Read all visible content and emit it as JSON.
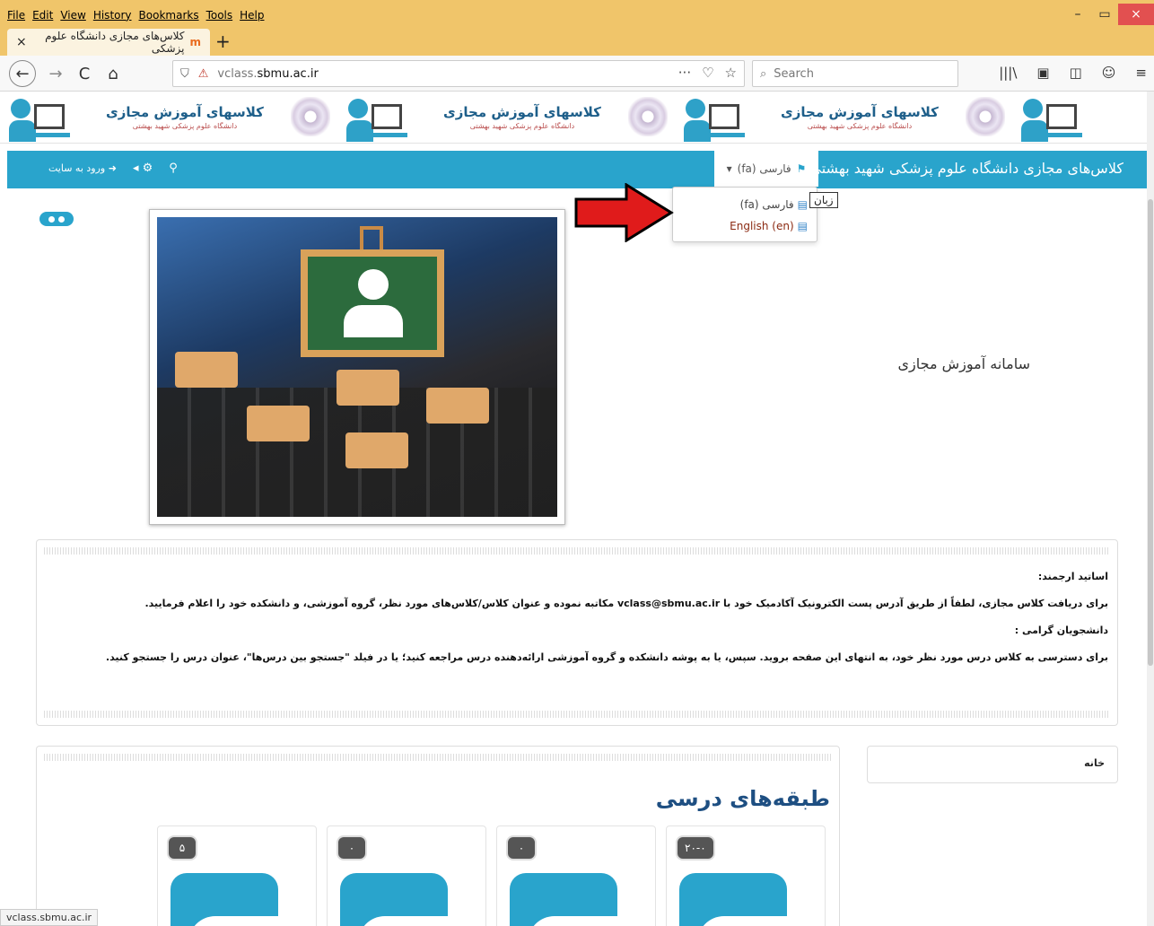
{
  "browser": {
    "menus": [
      "File",
      "Edit",
      "View",
      "History",
      "Bookmarks",
      "Tools",
      "Help"
    ],
    "window_controls": [
      "–",
      "▭",
      "×"
    ],
    "tab_title": "کلاس‌های مجازی دانشگاه علوم پزشکی",
    "tab_favicon": "m",
    "tab_close": "×",
    "new_tab": "+",
    "nav": {
      "back": "←",
      "forward": "→",
      "reload": "C",
      "home": "⌂"
    },
    "url_domain": "vclass.",
    "url_host": "sbmu.ac.ir",
    "url_actions": [
      "···",
      "♡",
      "☆"
    ],
    "search_placeholder": "Search",
    "toolbar_icons": [
      "|||\\",
      "▣",
      "◫",
      "☺",
      "≡"
    ],
    "status_url": "vclass.sbmu.ac.ir"
  },
  "banner": {
    "title": "کلاسهای آموزش مجازی",
    "subtitle": "دانشگاه علوم پزشکی شهید بهشتی"
  },
  "topnav": {
    "site_name": "کلاس‌های مجازی دانشگاه علوم پزشکی شهید بهشتی",
    "lang_current": "فارسی (fa)",
    "lang_caret": "▾",
    "login": "ورود به سایت",
    "accent": "#29a4cc"
  },
  "lang_menu": {
    "items": [
      "فارسی (fa)",
      "English (en)"
    ],
    "tooltip": "زبان"
  },
  "hero": {
    "title": "سامانه آموزش مجازی"
  },
  "notice": {
    "line1": "اساتید ارجمند:",
    "line2": "برای دریافت کلاس مجازی، لطفاً از طریق آدرس پست الکترونیک آکادمیک خود با vclass@sbmu.ac.ir مکاتبه نموده و عنوان کلاس/کلاس‌های مورد نظر، گروه آموزشی، و دانشکده خود را اعلام فرمایید.",
    "line3": "دانشجویان گرامی :",
    "line4": "برای دسترسی به کلاس درس مورد نظر خود، به انتهای این صفحه بروید. سپس، یا به پوشه دانشکده و گروه آموزشی ارائه‌دهنده درس مراجعه کنید؛ یا در فیلد \"جستجو بین درس‌ها\"، عنوان درس را جستجو کنید."
  },
  "categories": {
    "title": "طبقه‌های درسی",
    "cards": [
      {
        "count": "۵"
      },
      {
        "count": "۰"
      },
      {
        "count": "۰"
      },
      {
        "count": "۲۰-۰"
      }
    ]
  },
  "sidebar": {
    "home": "خانه"
  }
}
